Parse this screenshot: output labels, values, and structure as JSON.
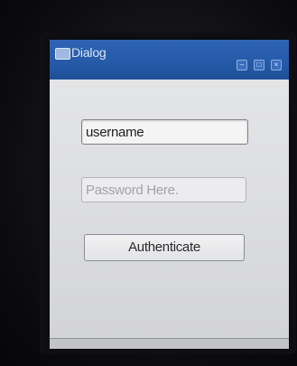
{
  "window": {
    "title": "Dialog",
    "controls": {
      "minimize": "–",
      "maximize": "□",
      "close": "×"
    }
  },
  "form": {
    "username": {
      "value": "username"
    },
    "password": {
      "value": "",
      "placeholder": "Password Here."
    },
    "authenticate_label": "Authenticate"
  },
  "colors": {
    "titlebar": "#245aa8",
    "window_bg": "#dcdde0",
    "field_bg": "#f4f4f5"
  },
  "icons": [
    "window-app-icon",
    "minimize-icon",
    "maximize-icon",
    "close-icon"
  ]
}
